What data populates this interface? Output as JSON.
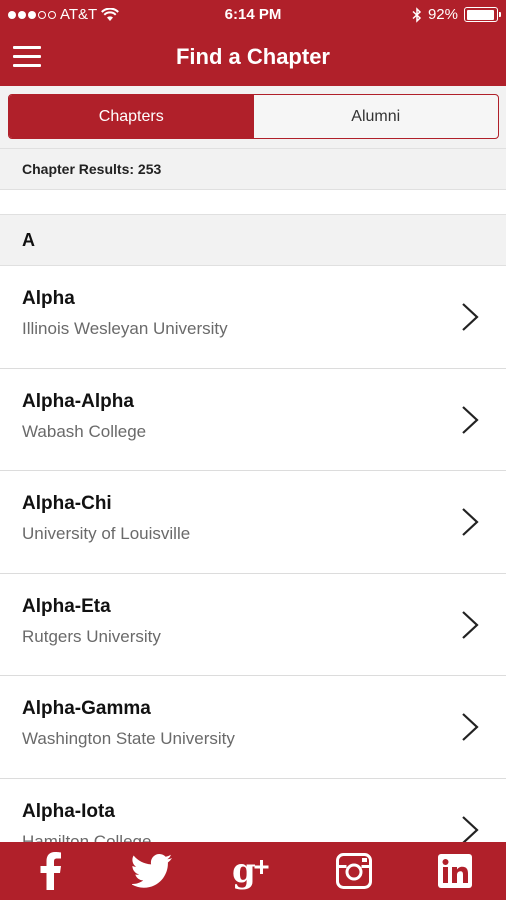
{
  "status_bar": {
    "carrier": "AT&T",
    "time": "6:14 PM",
    "battery": "92%"
  },
  "nav": {
    "title": "Find a Chapter"
  },
  "tabs": [
    {
      "label": "Chapters",
      "active": true
    },
    {
      "label": "Alumni",
      "active": false
    }
  ],
  "results": {
    "text": "Chapter Results: 253"
  },
  "section": {
    "letter": "A"
  },
  "chapters": [
    {
      "name": "Alpha",
      "school": "Illinois Wesleyan University"
    },
    {
      "name": "Alpha-Alpha",
      "school": "Wabash College"
    },
    {
      "name": "Alpha-Chi",
      "school": "University of Louisville"
    },
    {
      "name": "Alpha-Eta",
      "school": "Rutgers University"
    },
    {
      "name": "Alpha-Gamma",
      "school": "Washington State University"
    },
    {
      "name": "Alpha-Iota",
      "school": "Hamilton College"
    }
  ],
  "footer": {
    "icons": [
      "facebook-icon",
      "twitter-icon",
      "google-plus-icon",
      "instagram-icon",
      "linkedin-icon"
    ]
  },
  "colors": {
    "brand": "#b0202a",
    "background": "#ffffff",
    "panel": "#f2f2f2"
  }
}
